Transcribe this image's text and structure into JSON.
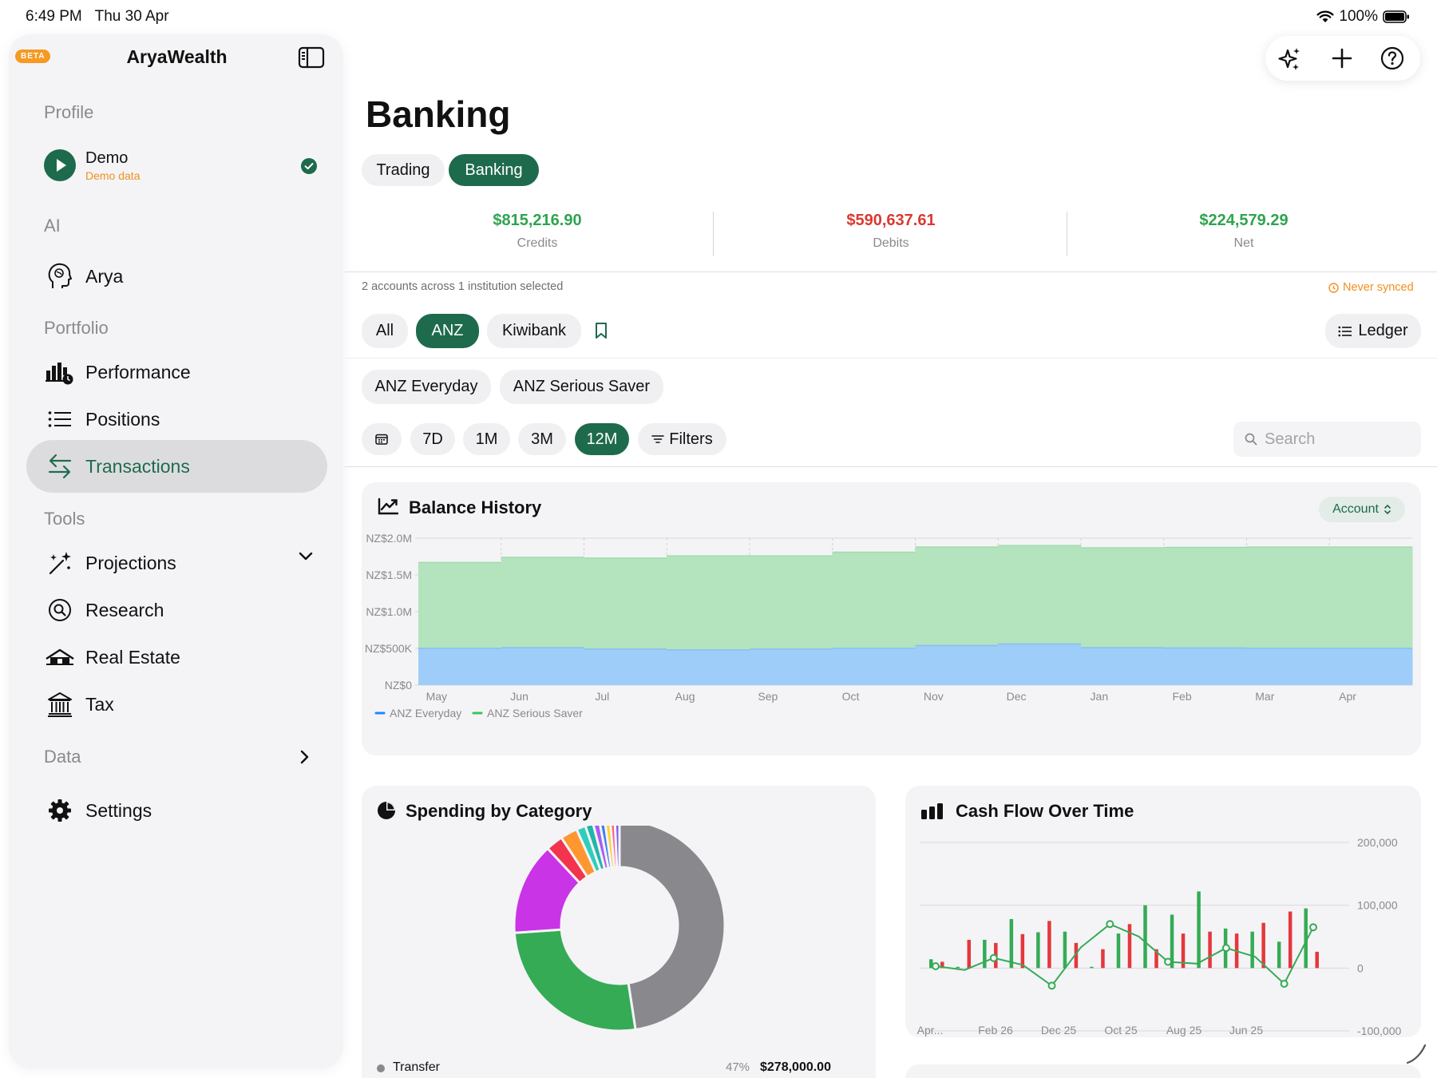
{
  "status_bar": {
    "time": "6:49 PM",
    "date": "Thu 30 Apr",
    "battery": "100%"
  },
  "sidebar": {
    "badge": "BETA",
    "app_name": "AryaWealth",
    "profile_header": "Profile",
    "profile": {
      "name": "Demo",
      "subtitle": "Demo data"
    },
    "ai_header": "AI",
    "ai_item": "Arya",
    "portfolio_header": "Portfolio",
    "portfolio_items": [
      "Performance",
      "Positions",
      "Transactions"
    ],
    "tools_header": "Tools",
    "tools_items": [
      "Projections",
      "Research",
      "Real Estate",
      "Tax"
    ],
    "data_header": "Data",
    "settings": "Settings"
  },
  "main": {
    "title": "Banking",
    "mode_tabs": [
      "Trading",
      "Banking"
    ],
    "stats": [
      {
        "value": "$815,216.90",
        "label": "Credits",
        "color": "#2ea44f"
      },
      {
        "value": "$590,637.61",
        "label": "Debits",
        "color": "#d93a32"
      },
      {
        "value": "$224,579.29",
        "label": "Net",
        "color": "#2ea44f"
      }
    ],
    "selection_info": "2 accounts across 1 institution selected",
    "sync_status": "Never synced",
    "institutions": [
      "All",
      "ANZ",
      "Kiwibank"
    ],
    "ledger_label": "Ledger",
    "accounts": [
      "ANZ Everyday",
      "ANZ Serious Saver"
    ],
    "ranges": [
      "7D",
      "1M",
      "3M",
      "12M"
    ],
    "filters_label": "Filters",
    "search_placeholder": "Search"
  },
  "balance_card": {
    "title": "Balance History",
    "account_button": "Account"
  },
  "spending_card": {
    "title": "Spending by Category"
  },
  "cashflow_card": {
    "title": "Cash Flow Over Time"
  },
  "chart_data": [
    {
      "type": "area",
      "title": "Balance History",
      "x": [
        "May",
        "Jun",
        "Jul",
        "Aug",
        "Sep",
        "Oct",
        "Nov",
        "Dec",
        "Jan",
        "Feb",
        "Mar",
        "Apr"
      ],
      "ytick_labels": [
        "NZ$0",
        "NZ$500K",
        "NZ$1.0M",
        "NZ$1.5M",
        "NZ$2.0M"
      ],
      "ylim": [
        0,
        2000000
      ],
      "stacked": true,
      "series": [
        {
          "name": "ANZ Everyday",
          "color": "#9ecdf9",
          "legend_color": "#1e88ff",
          "values": [
            500000,
            510000,
            490000,
            480000,
            490000,
            500000,
            540000,
            560000,
            510000,
            505000,
            500000,
            500000
          ]
        },
        {
          "name": "ANZ Serious Saver",
          "color": "#b3e4bd",
          "legend_color": "#34c759",
          "values": [
            1170000,
            1230000,
            1240000,
            1280000,
            1270000,
            1310000,
            1340000,
            1340000,
            1360000,
            1370000,
            1380000,
            1380000
          ]
        }
      ],
      "grid": true,
      "legend": "bottom-left"
    },
    {
      "type": "pie",
      "title": "Spending by Category",
      "donut": true,
      "slices": [
        {
          "label": "Transfer",
          "value": 47,
          "color": "#88888d"
        },
        {
          "label": "",
          "value": 26,
          "color": "#35ab55"
        },
        {
          "label": "",
          "value": 14,
          "color": "#c934e6"
        },
        {
          "label": "",
          "value": 2.6,
          "color": "#f2344e"
        },
        {
          "label": "",
          "value": 2.6,
          "color": "#ff9630"
        },
        {
          "label": "",
          "value": 1.4,
          "color": "#30cdbd"
        },
        {
          "label": "",
          "value": 1.2,
          "color": "#22b6a9"
        },
        {
          "label": "",
          "value": 1.0,
          "color": "#a95cf2"
        },
        {
          "label": "",
          "value": 0.8,
          "color": "#3f7cf5"
        },
        {
          "label": "",
          "value": 0.8,
          "color": "#ffd22e"
        },
        {
          "label": "",
          "value": 0.7,
          "color": "#ff5e8e"
        },
        {
          "label": "",
          "value": 0.7,
          "color": "#7c5cf0"
        }
      ],
      "legend_rows": [
        {
          "label": "Transfer",
          "percent": "47%",
          "amount": "$278,000.00",
          "color": "#88888d"
        }
      ]
    },
    {
      "type": "bar",
      "title": "Cash Flow Over Time",
      "xtick_labels": [
        "Apr...",
        "Feb 26",
        "Dec 25",
        "Oct 25",
        "Aug 25",
        "Jun 25"
      ],
      "ytick_labels": [
        "200,000",
        "100,000",
        "0",
        "-100,000"
      ],
      "ylim": [
        -100000,
        200000
      ],
      "series": [
        {
          "name": "",
          "color": "#35ab55",
          "values": [
            14000,
            2000,
            45000,
            78000,
            57000,
            58000,
            2000,
            55000,
            100000,
            85000,
            122000,
            63000,
            58000,
            42000,
            95000
          ]
        },
        {
          "name": "",
          "color": "#e5373d",
          "values": [
            10000,
            45000,
            40000,
            54000,
            75000,
            40000,
            30000,
            70000,
            30000,
            55000,
            58000,
            55000,
            72000,
            90000,
            26000
          ]
        },
        {
          "name": "",
          "color": "#35ab55",
          "kind": "line",
          "values": [
            3000,
            -3000,
            16000,
            5000,
            -28000,
            33000,
            70000,
            50000,
            10000,
            7000,
            32000,
            18000,
            -25000,
            65000
          ]
        }
      ]
    }
  ]
}
